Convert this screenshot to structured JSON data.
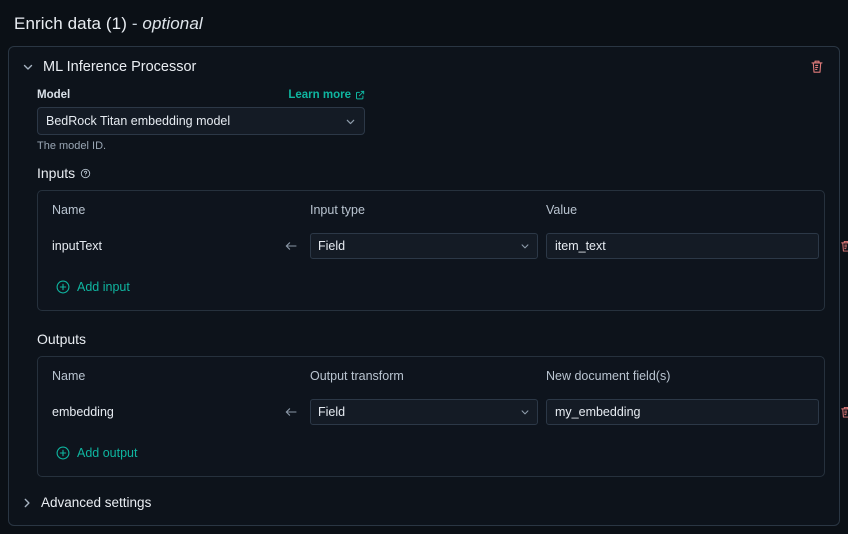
{
  "page": {
    "title_main": "Enrich data (1)",
    "title_sep": " - ",
    "title_optional": "optional"
  },
  "processor": {
    "collapse_icon": "chevron-down-icon",
    "name": "ML Inference Processor",
    "delete_icon": "trash-icon",
    "model": {
      "label": "Model",
      "learn_more": "Learn more",
      "learn_more_icon": "external-link-icon",
      "value": "BedRock Titan embedding model",
      "chevron_icon": "chevron-down-icon",
      "help_text": "The model ID."
    },
    "inputs": {
      "title": "Inputs",
      "help_icon": "question-circle-icon",
      "columns": [
        "Name",
        "Input type",
        "Value"
      ],
      "rows": [
        {
          "name": "inputText",
          "arrow_icon": "arrow-left-icon",
          "type": "Field",
          "value": "item_text",
          "delete_icon": "trash-icon"
        }
      ],
      "add_label": "Add input",
      "add_icon": "plus-circle-icon"
    },
    "outputs": {
      "title": "Outputs",
      "columns": [
        "Name",
        "Output transform",
        "New document field(s)"
      ],
      "rows": [
        {
          "name": "embedding",
          "arrow_icon": "arrow-left-icon",
          "type": "Field",
          "value": "my_embedding",
          "delete_icon": "trash-icon"
        }
      ],
      "add_label": "Add output",
      "add_icon": "plus-circle-icon"
    },
    "advanced": {
      "label": "Advanced settings",
      "chevron_icon": "chevron-right-icon"
    }
  },
  "colors": {
    "page_background": "#0b1016",
    "panel_background": "#0d131b",
    "panel_border": "#2a3643",
    "accent_teal": "#0fb5a0",
    "danger_red": "#e07b7b",
    "input_background": "#141b25",
    "input_border": "#2c3847",
    "text_primary": "#e9edf2",
    "text_muted": "#9aa7b5"
  }
}
